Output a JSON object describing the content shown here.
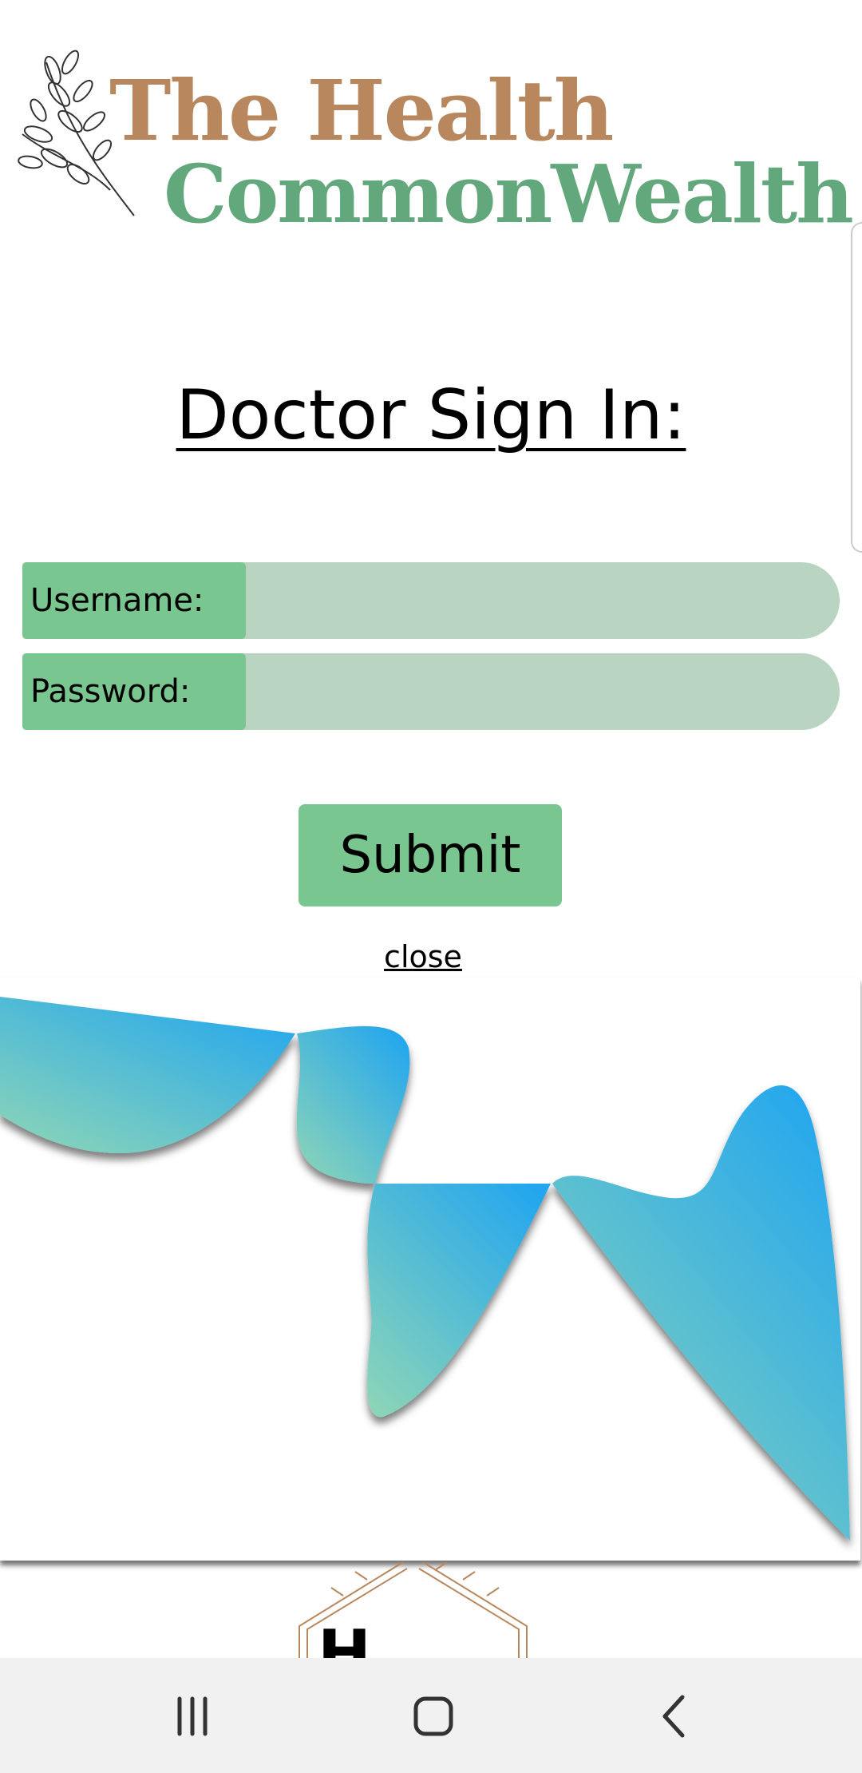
{
  "logo": {
    "line1": "The Health",
    "line2": "CommonWealth",
    "brand_color_1": "#b9875d",
    "brand_color_2": "#63a77c",
    "icon": "olive-branch-icon"
  },
  "heading": "Doctor Sign In:",
  "form": {
    "username_label": "Username:",
    "username_value": "",
    "password_label": "Password:",
    "password_value": "",
    "submit_label": "Submit",
    "close_label": "close"
  },
  "colors": {
    "label_bg": "#79c690",
    "field_bg": "#b9d5c2",
    "wave_top": "#22a6ef",
    "wave_bottom": "#8ad4b8"
  },
  "navbar": {
    "recents_icon": "recent-apps-icon",
    "home_icon": "home-icon",
    "back_icon": "back-icon"
  }
}
